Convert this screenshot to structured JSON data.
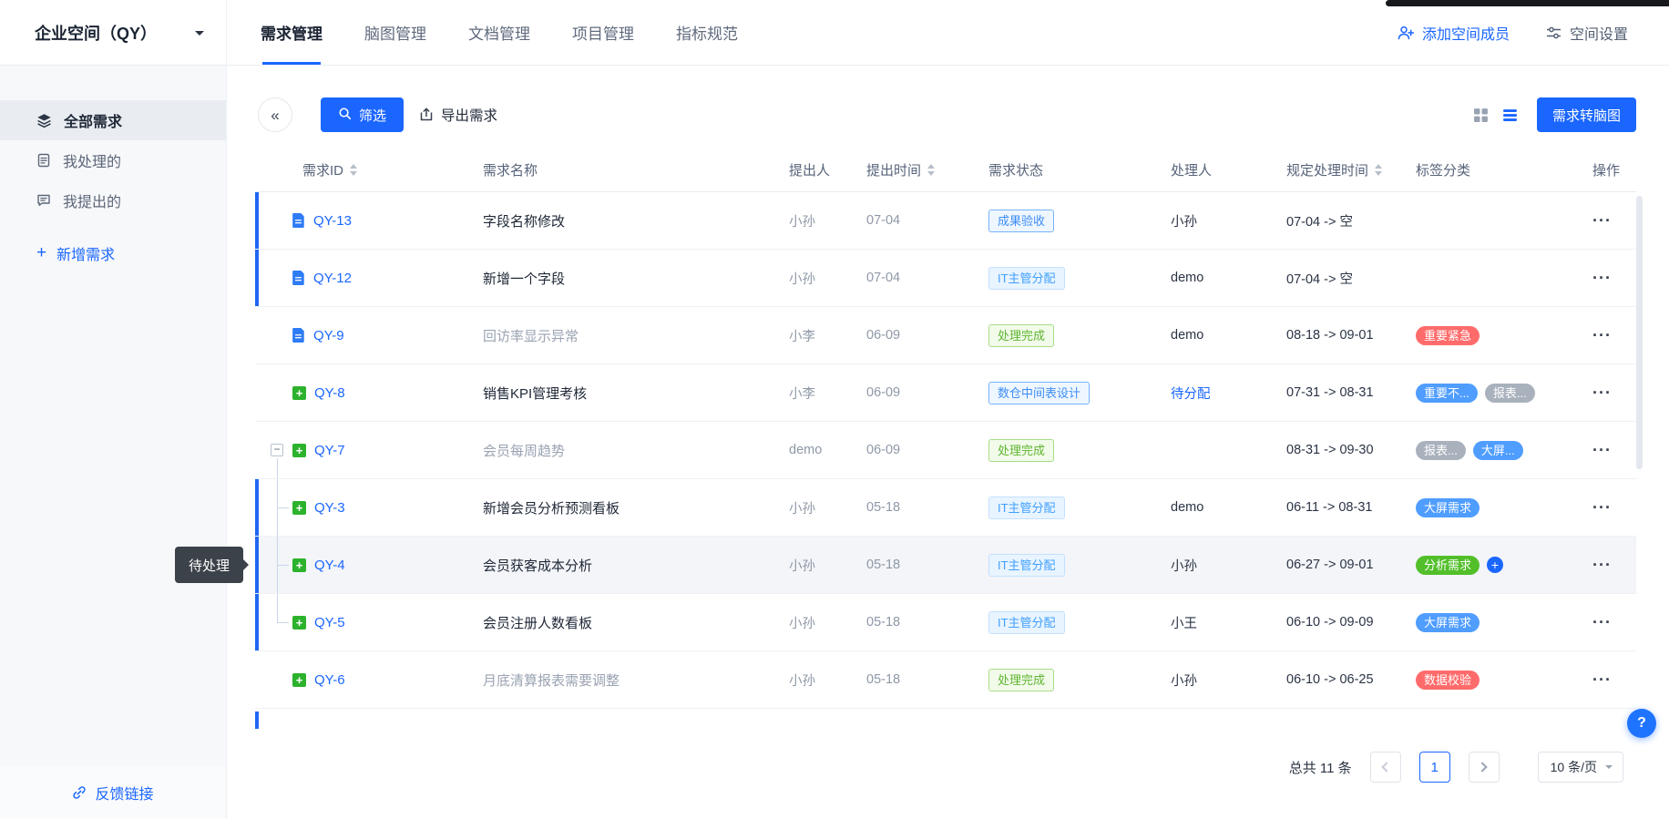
{
  "colors": {
    "accent": "#1a66ff",
    "tag_red": "#ff6b6b",
    "tag_blue": "#4f9dff",
    "tag_gray": "#a9b1bd",
    "tag_green": "#52bf2a"
  },
  "icons": {
    "panel_collapse": "«",
    "row_actions": "···",
    "collapse_minus": "−",
    "plus": "+"
  },
  "top_bar": {
    "workspace": "企业空间（QY）",
    "tabs": [
      {
        "label": "需求管理",
        "active": true
      },
      {
        "label": "脑图管理",
        "active": false
      },
      {
        "label": "文档管理",
        "active": false
      },
      {
        "label": "项目管理",
        "active": false
      },
      {
        "label": "指标规范",
        "active": false
      }
    ],
    "add_member": "添加空间成员",
    "space_settings": "空间设置"
  },
  "sidebar": {
    "items": [
      {
        "label": "全部需求",
        "icon": "layers-icon",
        "active": true
      },
      {
        "label": "我处理的",
        "icon": "doc-icon",
        "active": false
      },
      {
        "label": "我提出的",
        "icon": "comment-icon",
        "active": false
      }
    ],
    "new_requirement": "新增需求",
    "feedback": "反馈链接"
  },
  "toolbar": {
    "filter": "筛选",
    "export": "导出需求",
    "to_mindmap": "需求转脑图"
  },
  "table": {
    "columns": [
      {
        "label": "需求ID",
        "sortable": true
      },
      {
        "label": "需求名称",
        "sortable": false
      },
      {
        "label": "提出人",
        "sortable": false
      },
      {
        "label": "提出时间",
        "sortable": true
      },
      {
        "label": "需求状态",
        "sortable": false
      },
      {
        "label": "处理人",
        "sortable": false
      },
      {
        "label": "规定处理时间",
        "sortable": true
      },
      {
        "label": "标签分类",
        "sortable": false
      },
      {
        "label": "操作",
        "sortable": false
      }
    ],
    "rows": [
      {
        "id": "QY-13",
        "icon": "doc",
        "name": "字段名称修改",
        "muted": false,
        "proposer": "小孙",
        "proposed": "07-04",
        "status": {
          "label": "成果验收",
          "style": "outline"
        },
        "handler": "小孙",
        "handler_link": false,
        "deadline": "07-04 -> 空",
        "tags": [],
        "add_tag": false,
        "selected": true,
        "tree": "",
        "hover": false
      },
      {
        "id": "QY-12",
        "icon": "doc",
        "name": "新增一个字段",
        "muted": false,
        "proposer": "小孙",
        "proposed": "07-04",
        "status": {
          "label": "IT主管分配",
          "style": "fill"
        },
        "handler": "demo",
        "handler_link": false,
        "deadline": "07-04 -> 空",
        "tags": [],
        "add_tag": false,
        "selected": true,
        "tree": "",
        "hover": false
      },
      {
        "id": "QY-9",
        "icon": "doc",
        "name": "回访率显示异常",
        "muted": true,
        "proposer": "小李",
        "proposed": "06-09",
        "status": {
          "label": "处理完成",
          "style": "green"
        },
        "handler": "demo",
        "handler_link": false,
        "deadline": "08-18 -> 09-01",
        "tags": [
          {
            "label": "重要紧急",
            "color": "red"
          }
        ],
        "add_tag": false,
        "selected": false,
        "tree": "",
        "hover": false
      },
      {
        "id": "QY-8",
        "icon": "plus",
        "name": "销售KPI管理考核",
        "muted": false,
        "proposer": "小李",
        "proposed": "06-09",
        "status": {
          "label": "数仓中间表设计",
          "style": "outline"
        },
        "handler": "待分配",
        "handler_link": true,
        "deadline": "07-31 -> 08-31",
        "tags": [
          {
            "label": "重要不...",
            "color": "blue"
          },
          {
            "label": "报表...",
            "color": "gray"
          }
        ],
        "add_tag": false,
        "selected": false,
        "tree": "",
        "hover": false
      },
      {
        "id": "QY-7",
        "icon": "plus",
        "name": "会员每周趋势",
        "muted": true,
        "proposer": "demo",
        "proposed": "06-09",
        "status": {
          "label": "处理完成",
          "style": "green"
        },
        "handler": "",
        "handler_link": false,
        "deadline": "08-31 -> 09-30",
        "tags": [
          {
            "label": "报表...",
            "color": "gray"
          },
          {
            "label": "大屏...",
            "color": "blue"
          }
        ],
        "add_tag": false,
        "selected": false,
        "tree": "parent",
        "hover": false
      },
      {
        "id": "QY-3",
        "icon": "plus",
        "name": "新增会员分析预测看板",
        "muted": false,
        "proposer": "小孙",
        "proposed": "05-18",
        "status": {
          "label": "IT主管分配",
          "style": "fill"
        },
        "handler": "demo",
        "handler_link": false,
        "deadline": "06-11 -> 08-31",
        "tags": [
          {
            "label": "大屏需求",
            "color": "blue"
          }
        ],
        "add_tag": false,
        "selected": true,
        "tree": "mid",
        "hover": false
      },
      {
        "id": "QY-4",
        "icon": "plus",
        "name": "会员获客成本分析",
        "muted": false,
        "proposer": "小孙",
        "proposed": "05-18",
        "status": {
          "label": "IT主管分配",
          "style": "fill"
        },
        "handler": "小孙",
        "handler_link": false,
        "deadline": "06-27 -> 09-01",
        "tags": [
          {
            "label": "分析需求",
            "color": "green"
          }
        ],
        "add_tag": true,
        "selected": true,
        "tree": "mid",
        "hover": true
      },
      {
        "id": "QY-5",
        "icon": "plus",
        "name": "会员注册人数看板",
        "muted": false,
        "proposer": "小孙",
        "proposed": "05-18",
        "status": {
          "label": "IT主管分配",
          "style": "fill"
        },
        "handler": "小王",
        "handler_link": false,
        "deadline": "06-10 -> 09-09",
        "tags": [
          {
            "label": "大屏需求",
            "color": "blue"
          }
        ],
        "add_tag": false,
        "selected": true,
        "tree": "last",
        "hover": false
      },
      {
        "id": "QY-6",
        "icon": "plus",
        "name": "月底清算报表需要调整",
        "muted": true,
        "proposer": "小孙",
        "proposed": "05-18",
        "status": {
          "label": "处理完成",
          "style": "green"
        },
        "handler": "小孙",
        "handler_link": false,
        "deadline": "06-10 -> 06-25",
        "tags": [
          {
            "label": "数据校验",
            "color": "red"
          }
        ],
        "add_tag": false,
        "selected": false,
        "tree": "",
        "hover": false
      }
    ]
  },
  "tooltip": {
    "text": "待处理"
  },
  "pagination": {
    "total": "总共 11 条",
    "current_page": "1",
    "page_size": "10 条/页"
  },
  "help": {
    "label": "?"
  }
}
